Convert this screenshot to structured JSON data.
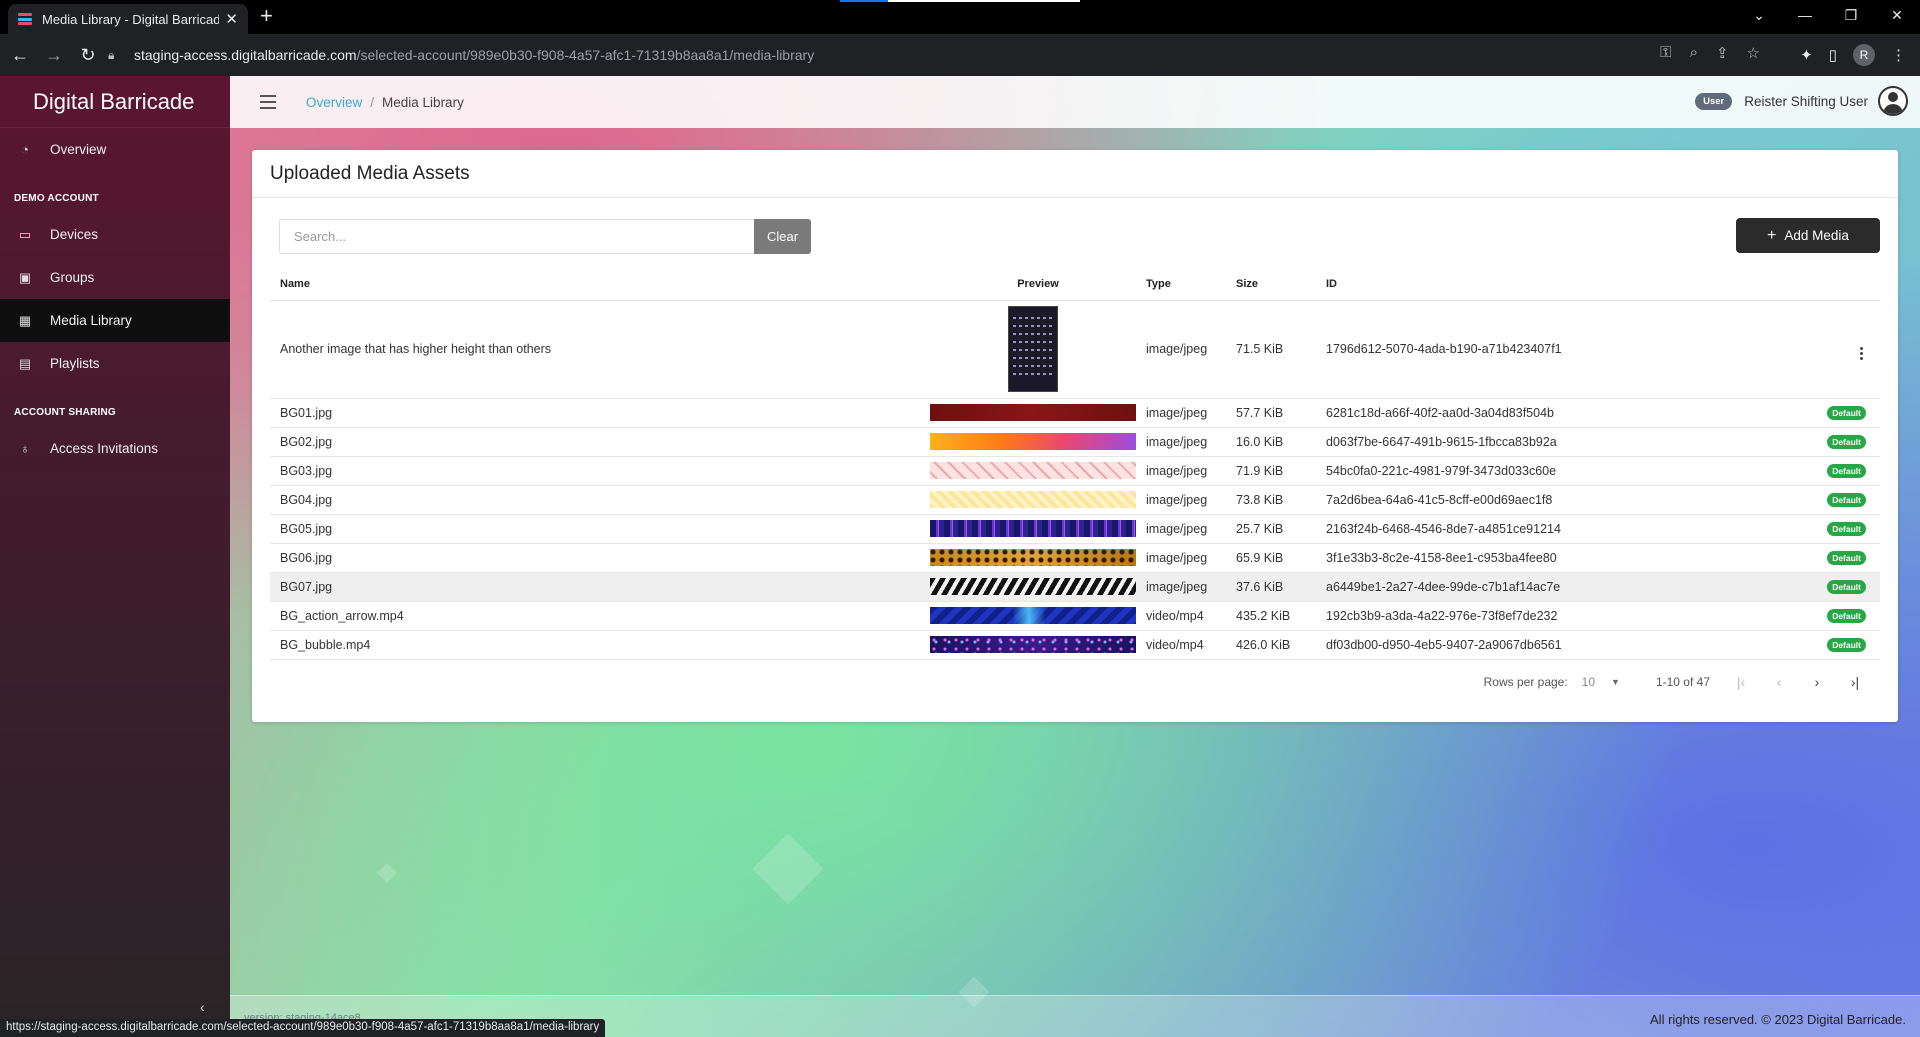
{
  "browser": {
    "tab_title": "Media Library - Digital Barricade",
    "tab_close": "✕",
    "new_tab": "+",
    "url_host": "staging-access.digitalbarricade.com",
    "url_path": "/selected-account/989e0b30-f908-4a57-afc1-71319b8aa8a1/media-library",
    "profile_initial": "R",
    "status_url": "https://staging-access.digitalbarricade.com/selected-account/989e0b30-f908-4a57-afc1-71319b8aa8a1/media-library"
  },
  "sidebar": {
    "brand": "Digital Barricade",
    "items": [
      {
        "label": "Overview",
        "icon": "dashboard-icon"
      }
    ],
    "section_demo": "DEMO ACCOUNT",
    "demo_items": [
      {
        "label": "Devices",
        "icon": "devices-icon"
      },
      {
        "label": "Groups",
        "icon": "groups-icon"
      },
      {
        "label": "Media Library",
        "icon": "film-icon",
        "active": true
      },
      {
        "label": "Playlists",
        "icon": "playlist-icon"
      }
    ],
    "section_sharing": "ACCOUNT SHARING",
    "sharing_items": [
      {
        "label": "Access Invitations",
        "icon": "invitation-icon"
      }
    ],
    "version": "version: staging-14ace8"
  },
  "header": {
    "breadcrumb_link": "Overview",
    "breadcrumb_sep": "/",
    "breadcrumb_current": "Media Library",
    "role_badge": "User",
    "user_name": "Reister Shifting User"
  },
  "card": {
    "title": "Uploaded Media Assets",
    "search_placeholder": "Search...",
    "clear_label": "Clear",
    "add_label": "Add Media",
    "columns": {
      "name": "Name",
      "preview": "Preview",
      "type": "Type",
      "size": "Size",
      "id": "ID"
    },
    "rows": [
      {
        "name": "Another image that has higher height than others",
        "type": "image/jpeg",
        "size": "71.5 KiB",
        "id": "1796d612-5070-4ada-b190-a71b423407f1",
        "badge": ""
      },
      {
        "name": "BG01.jpg",
        "type": "image/jpeg",
        "size": "57.7 KiB",
        "id": "6281c18d-a66f-40f2-aa0d-3a04d83f504b",
        "badge": "Default"
      },
      {
        "name": "BG02.jpg",
        "type": "image/jpeg",
        "size": "16.0 KiB",
        "id": "d063f7be-6647-491b-9615-1fbcca83b92a",
        "badge": "Default"
      },
      {
        "name": "BG03.jpg",
        "type": "image/jpeg",
        "size": "71.9 KiB",
        "id": "54bc0fa0-221c-4981-979f-3473d033c60e",
        "badge": "Default"
      },
      {
        "name": "BG04.jpg",
        "type": "image/jpeg",
        "size": "73.8 KiB",
        "id": "7a2d6bea-64a6-41c5-8cff-e00d69aec1f8",
        "badge": "Default"
      },
      {
        "name": "BG05.jpg",
        "type": "image/jpeg",
        "size": "25.7 KiB",
        "id": "2163f24b-6468-4546-8de7-a4851ce91214",
        "badge": "Default"
      },
      {
        "name": "BG06.jpg",
        "type": "image/jpeg",
        "size": "65.9 KiB",
        "id": "3f1e33b3-8c2e-4158-8ee1-c953ba4fee80",
        "badge": "Default"
      },
      {
        "name": "BG07.jpg",
        "type": "image/jpeg",
        "size": "37.6 KiB",
        "id": "a6449be1-2a27-4dee-99de-c7b1af14ac7e",
        "badge": "Default"
      },
      {
        "name": "BG_action_arrow.mp4",
        "type": "video/mp4",
        "size": "435.2 KiB",
        "id": "192cb3b9-a3da-4a22-976e-73f8ef7de232",
        "badge": "Default"
      },
      {
        "name": "BG_bubble.mp4",
        "type": "video/mp4",
        "size": "426.0 KiB",
        "id": "df03db00-d950-4eb5-9407-2a9067db6561",
        "badge": "Default"
      }
    ],
    "pager": {
      "rows_per_page_label": "Rows per page:",
      "rows_per_page_value": "10",
      "range": "1-10 of 47"
    }
  },
  "footer": {
    "copyright": "All rights reserved. © 2023 Digital Barricade."
  }
}
